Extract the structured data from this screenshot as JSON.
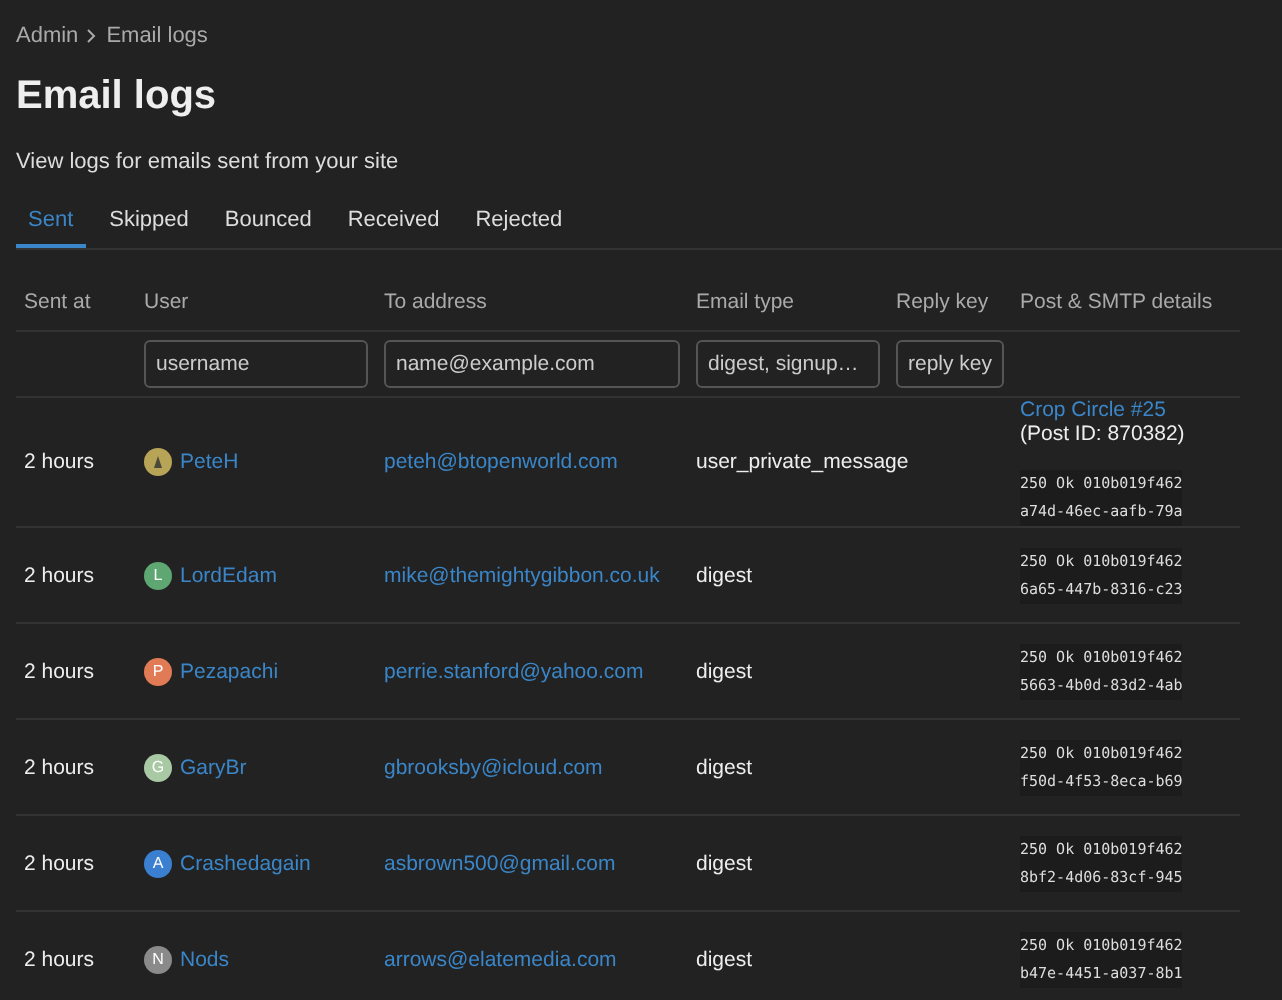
{
  "breadcrumb": [
    "Admin",
    "Email logs"
  ],
  "title": "Email logs",
  "description": "View logs for emails sent from your site",
  "tabs": [
    {
      "label": "Sent",
      "selected": true
    },
    {
      "label": "Skipped",
      "selected": false
    },
    {
      "label": "Bounced",
      "selected": false
    },
    {
      "label": "Received",
      "selected": false
    },
    {
      "label": "Rejected",
      "selected": false
    }
  ],
  "table": {
    "columns": [
      "Sent at",
      "User",
      "To address",
      "Email type",
      "Reply key",
      "Post & SMTP details"
    ],
    "filters": [
      {
        "placeholder": "username"
      },
      {
        "placeholder": "name@example.com"
      },
      {
        "placeholder": "digest, signup…"
      },
      {
        "placeholder": "reply key"
      }
    ],
    "rows": [
      {
        "sent_at": "2 hours",
        "avatar": {
          "kind": "image",
          "color": "#b8a456"
        },
        "user": "PeteH",
        "to": "peteh@btopenworld.com",
        "type": "user_private_message",
        "post": {
          "title": "Crop Circle #25",
          "id": "(Post ID: 870382)"
        },
        "smtp": [
          "250 Ok 010b019f462",
          "a74d-46ec-aafb-79a"
        ]
      },
      {
        "sent_at": "2 hours",
        "avatar": {
          "kind": "letter",
          "letter": "L",
          "color": "#5ea672"
        },
        "user": "LordEdam",
        "to": "mike@themightygibbon.co.uk",
        "type": "digest",
        "smtp": [
          "250 Ok 010b019f462",
          "6a65-447b-8316-c23"
        ]
      },
      {
        "sent_at": "2 hours",
        "avatar": {
          "kind": "letter",
          "letter": "P",
          "color": "#e07b56"
        },
        "user": "Pezapachi",
        "to": "perrie.stanford@yahoo.com",
        "type": "digest",
        "smtp": [
          "250 Ok 010b019f462",
          "5663-4b0d-83d2-4ab"
        ]
      },
      {
        "sent_at": "2 hours",
        "avatar": {
          "kind": "letter",
          "letter": "G",
          "color": "#a8c9a3"
        },
        "user": "GaryBr",
        "to": "gbrooksby@icloud.com",
        "type": "digest",
        "smtp": [
          "250 Ok 010b019f462",
          "f50d-4f53-8eca-b69"
        ]
      },
      {
        "sent_at": "2 hours",
        "avatar": {
          "kind": "letter",
          "letter": "A",
          "color": "#3a7fd0"
        },
        "user": "Crashedagain",
        "to": "asbrown500@gmail.com",
        "type": "digest",
        "smtp": [
          "250 Ok 010b019f462",
          "8bf2-4d06-83cf-945"
        ]
      },
      {
        "sent_at": "2 hours",
        "avatar": {
          "kind": "letter",
          "letter": "N",
          "color": "#8a8a8a"
        },
        "user": "Nods",
        "to": "arrows@elatemedia.com",
        "type": "digest",
        "smtp": [
          "250 Ok 010b019f462",
          "b47e-4451-a037-8b1"
        ]
      }
    ]
  }
}
